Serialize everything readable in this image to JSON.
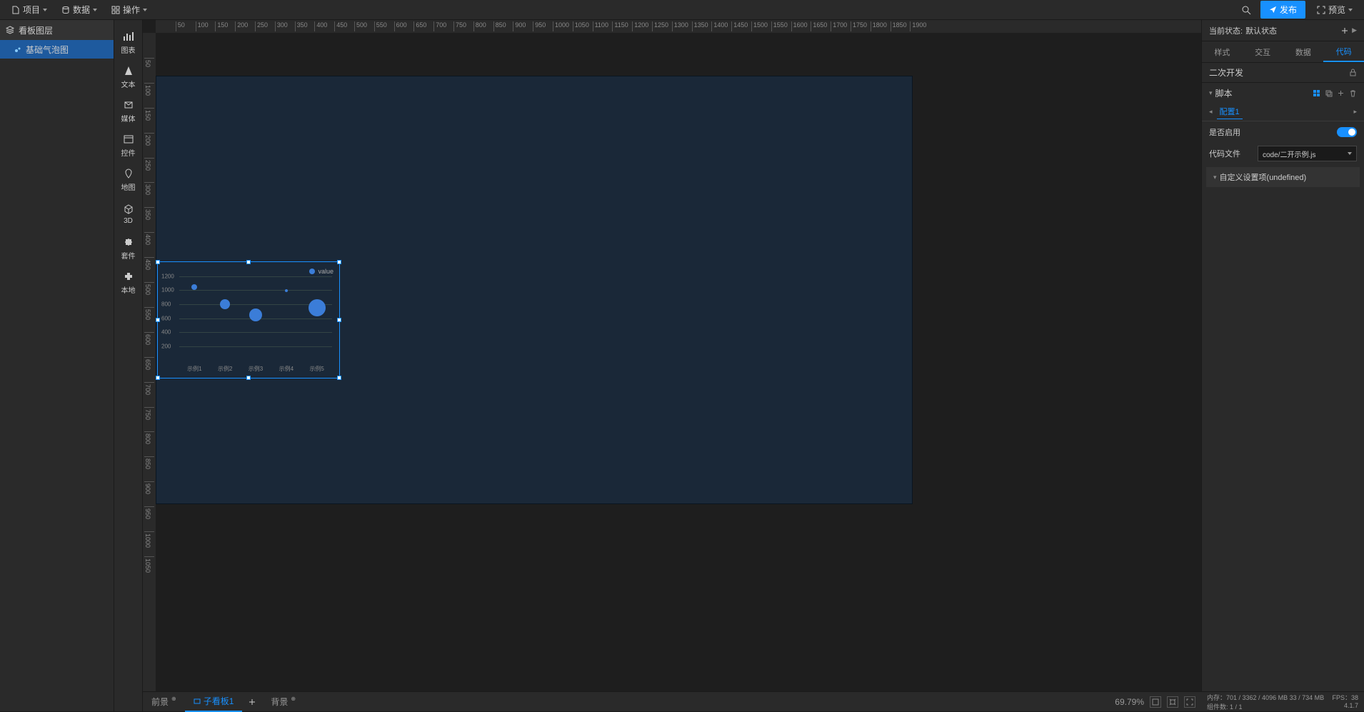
{
  "topbar": {
    "project": "项目",
    "data": "数据",
    "operations": "操作",
    "publish": "发布",
    "preview": "预览"
  },
  "leftPanel": {
    "header": "看板图层",
    "layer1": "基础气泡图"
  },
  "toolbar": {
    "chart": "图表",
    "text": "文本",
    "media": "媒体",
    "control": "控件",
    "map": "地图",
    "threed": "3D",
    "suite": "套件",
    "local": "本地"
  },
  "ruler": {
    "h": [
      "50",
      "100",
      "150",
      "200",
      "250",
      "300",
      "350",
      "400",
      "450",
      "500",
      "550",
      "600",
      "650",
      "700",
      "750",
      "800",
      "850",
      "900",
      "950",
      "1000",
      "1050",
      "1100",
      "1150",
      "1200",
      "1250",
      "1300",
      "1350",
      "1400",
      "1450",
      "1500",
      "1550",
      "1600",
      "1650",
      "1700",
      "1750",
      "1800",
      "1850",
      "1900"
    ],
    "v": [
      "50",
      "100",
      "150",
      "200",
      "250",
      "300",
      "350",
      "400",
      "450",
      "500",
      "550",
      "600",
      "650",
      "700",
      "750",
      "800",
      "850",
      "900",
      "950",
      "1000",
      "1050"
    ]
  },
  "chart_data": {
    "type": "scatter",
    "title": "",
    "legend": "value",
    "categories": [
      "示例1",
      "示例2",
      "示例3",
      "示例4",
      "示例5"
    ],
    "ylim": [
      0,
      1200
    ],
    "yticks": [
      200,
      400,
      600,
      800,
      1000,
      1200
    ],
    "series": [
      {
        "name": "value",
        "points": [
          {
            "x": "示例1",
            "y": 1050,
            "size": 4
          },
          {
            "x": "示例2",
            "y": 800,
            "size": 7
          },
          {
            "x": "示例3",
            "y": 650,
            "size": 9
          },
          {
            "x": "示例4",
            "y": 1000,
            "size": 2
          },
          {
            "x": "示例5",
            "y": 750,
            "size": 12
          }
        ]
      }
    ]
  },
  "bottomTabs": {
    "foreground": "前景",
    "subboard": "子看板1",
    "background": "背景",
    "zoom": "69.79%"
  },
  "rightPanel": {
    "stateLabel": "当前状态:",
    "stateValue": "默认状态",
    "tabs": {
      "style": "样式",
      "interact": "交互",
      "data": "数据",
      "code": "代码"
    },
    "secondaryDev": "二次开发",
    "scriptSection": "脚本",
    "scriptTab": "配置1",
    "enableLabel": "是否启用",
    "codeFileLabel": "代码文件",
    "codeFileValue": "code/二开示例.js",
    "customSection": "自定义设置项(undefined)"
  },
  "statusbar": {
    "memLabel": "内存：",
    "memValue": "701 / 3362 / 4096 MB  33 / 734 MB",
    "fpsLabel": "FPS：",
    "fpsValue": "38",
    "compLabel": "组件数: ",
    "compValue": "1 / 1",
    "version": "4.1.7"
  }
}
